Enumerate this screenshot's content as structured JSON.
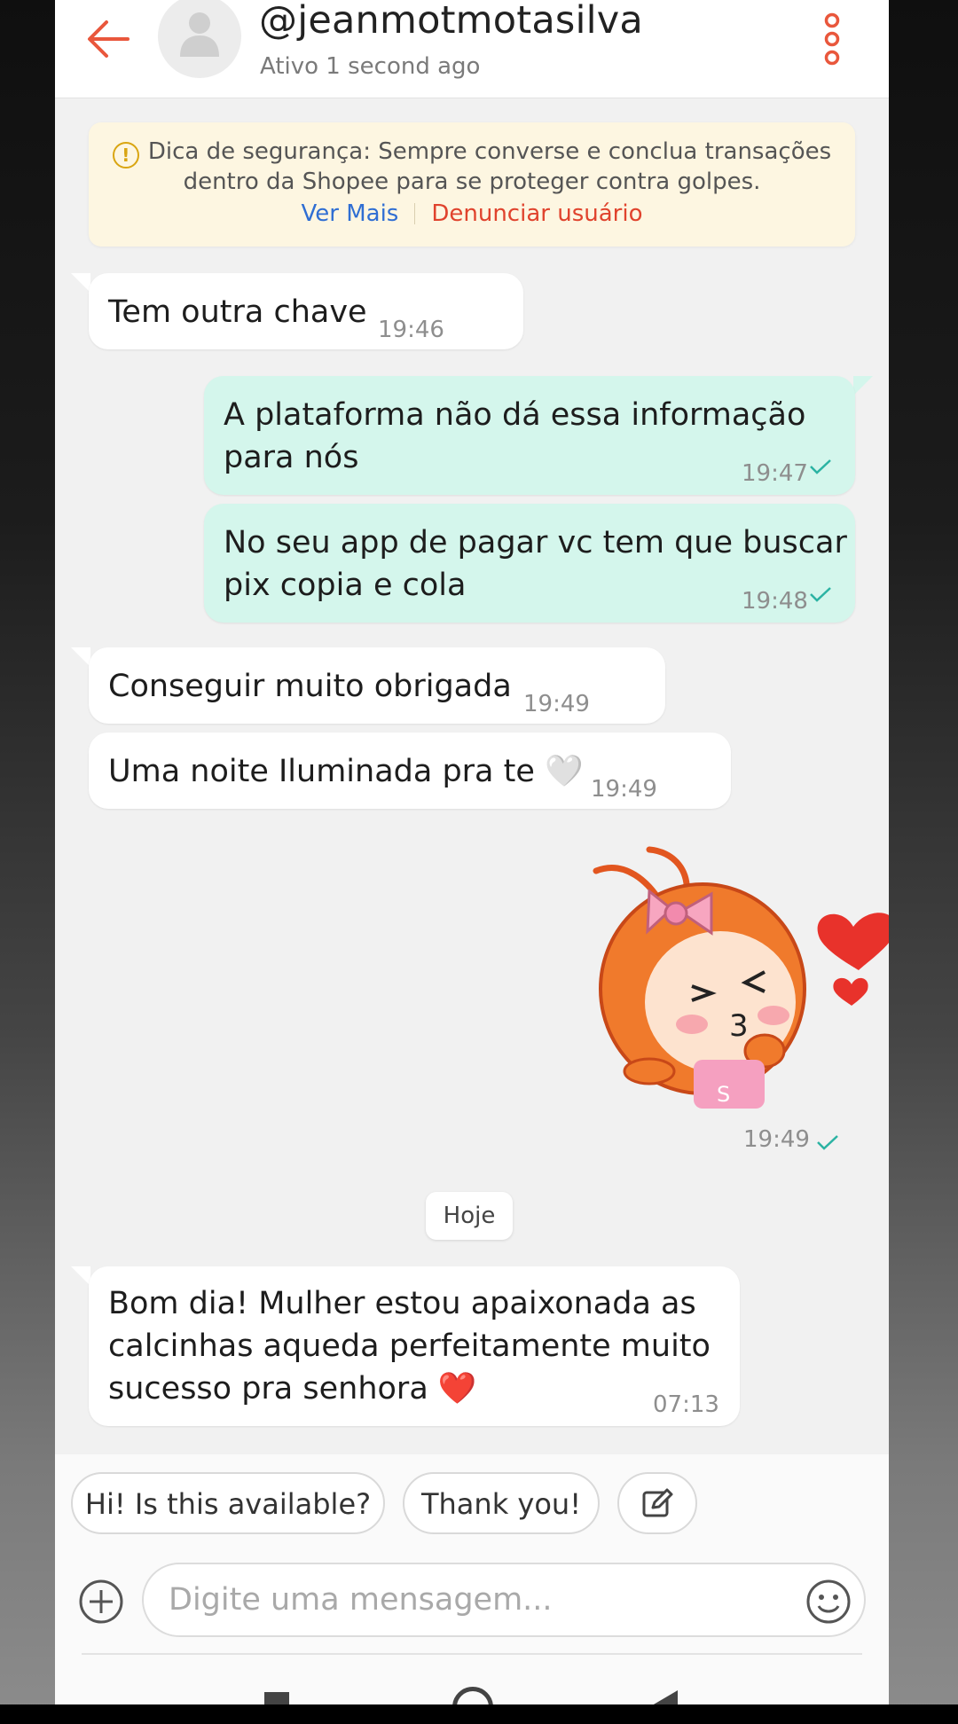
{
  "header": {
    "username": "@jeanmotmotasilva",
    "status": "Ativo 1 second ago"
  },
  "safety_tip": {
    "line1": "Dica de segurança: Sempre converse e conclua transações",
    "line2": "dentro da Shopee para se proteger contra golpes.",
    "see_more": "Ver Mais",
    "report": "Denunciar usuário"
  },
  "messages": [
    {
      "side": "in",
      "lines": [
        "Tem outra chave"
      ],
      "time": "19:46"
    },
    {
      "side": "out",
      "lines": [
        "A plataforma não dá essa informação",
        "para nós"
      ],
      "time": "19:47"
    },
    {
      "side": "out",
      "lines": [
        "No seu app de pagar vc tem que buscar",
        "pix copia e cola"
      ],
      "time": "19:48"
    },
    {
      "side": "in",
      "lines": [
        "Conseguir muito obrigada"
      ],
      "time": "19:49"
    },
    {
      "side": "in",
      "lines": [
        "Uma noite Iluminada pra te 🤍"
      ],
      "time": "19:49"
    },
    {
      "side": "out",
      "type": "sticker",
      "sticker_letter": "S",
      "time": "19:49"
    },
    {
      "side": "in",
      "lines": [
        "Bom dia! Mulher estou apaixonada as",
        "calcinhas aqueda perfeitamente muito",
        "sucesso pra senhora ❤️"
      ],
      "time": "07:13"
    }
  ],
  "date_divider": "Hoje",
  "quick_replies": [
    "Hi! Is this available?",
    "Thank you!"
  ],
  "composer": {
    "placeholder": "Digite uma mensagem..."
  },
  "colors": {
    "accent": "#ee4d2d",
    "outgoing_bubble": "#d4f6ec",
    "check": "#2bb3a3"
  }
}
